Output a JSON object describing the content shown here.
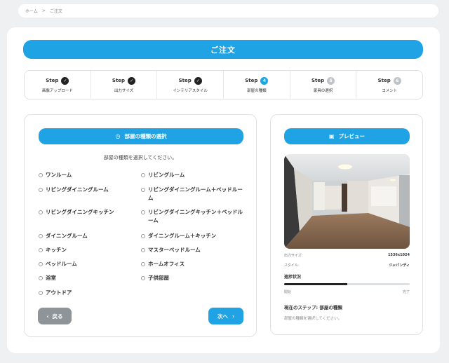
{
  "breadcrumb": {
    "home": "ホーム",
    "separator": ">",
    "current": "ご注文"
  },
  "title": "ご注文",
  "steps": [
    {
      "word": "Step",
      "badge": "✓",
      "status": "done",
      "name": "画像アップロード"
    },
    {
      "word": "Step",
      "badge": "✓",
      "status": "done",
      "name": "出力サイズ"
    },
    {
      "word": "Step",
      "badge": "✓",
      "status": "done",
      "name": "インテリアスタイル"
    },
    {
      "word": "Step",
      "badge": "4",
      "status": "current",
      "name": "部屋の種類"
    },
    {
      "word": "Step",
      "badge": "5",
      "status": "todo",
      "name": "家具の選択"
    },
    {
      "word": "Step",
      "badge": "6",
      "status": "todo",
      "name": "コメント"
    }
  ],
  "room_select": {
    "header_icon": "clock-icon",
    "header": "部屋の種類の選択",
    "instruction": "部屋の種類を選択してください。",
    "options": [
      "ワンルーム",
      "リビングルーム",
      "リビングダイニングルーム",
      "リビングダイニングルーム＋ベッドルーム",
      "リビングダイニングキッチン",
      "リビングダイニングキッチン＋ベッドルーム",
      "ダイニングルーム",
      "ダイニングルーム＋キッチン",
      "キッチン",
      "マスターベッドルーム",
      "ベッドルーム",
      "ホームオフィス",
      "浴室",
      "子供部屋",
      "アウトドア"
    ],
    "back_label": "戻る",
    "next_label": "次へ"
  },
  "preview": {
    "header_icon": "image-icon",
    "header": "プレビュー",
    "size_label": "出力サイズ:",
    "size_value": "1536x1024",
    "style_label": "スタイル:",
    "style_value": "ジャパンディ",
    "progress_title": "進捗状況",
    "progress_value": 0.5,
    "progress_start": "開始",
    "progress_end": "完了",
    "current_step": "現在のステップ: 部屋の種類",
    "current_desc": "部屋の種類を選択してください。"
  },
  "colors": {
    "accent": "#1fa3e4",
    "done": "#222222",
    "todo": "#bfc4c8",
    "back": "#8f9499"
  }
}
